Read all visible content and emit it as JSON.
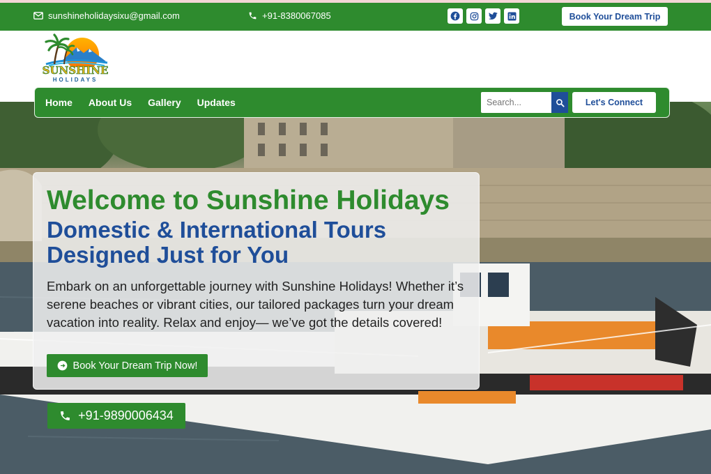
{
  "topbar": {
    "email": "sunshineholidaysixu@gmail.com",
    "phone": "+91-8380067085",
    "social": [
      "facebook-icon",
      "instagram-icon",
      "twitter-icon",
      "linkedin-icon"
    ],
    "cta": "Book Your Dream Trip"
  },
  "logo": {
    "word": "SUNSHINE",
    "sub": "HOLIDAYS"
  },
  "nav": {
    "links": [
      "Home",
      "About Us",
      "Gallery",
      "Updates"
    ],
    "search_placeholder": "Search...",
    "connect": "Let's Connect"
  },
  "hero": {
    "title": "Welcome to Sunshine Holidays",
    "subtitle": "Domestic & International Tours Designed Just for You",
    "body": "Embark on an unforgettable journey with Sunshine Holidays! Whether it’s serene beaches or vibrant cities, our tailored packages turn your dream vacation into reality. Relax and enjoy— we’ve got the details covered!",
    "button": "Book Your Dream Trip Now!",
    "phone": "+91-9890006434"
  },
  "colors": {
    "green": "#2e8b2e",
    "blue": "#1f4e99"
  }
}
